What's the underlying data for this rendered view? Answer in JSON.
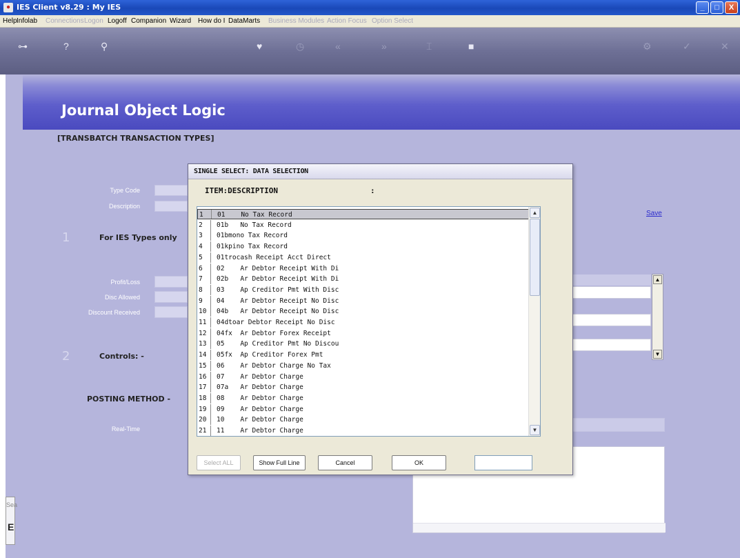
{
  "window": {
    "title": "IES Client v8.29 : My IES",
    "app_icon": "ies-logo-icon",
    "controls": {
      "minimize": "_",
      "maximize": "□",
      "close": "X"
    }
  },
  "menu": {
    "items": [
      {
        "label": "Help",
        "enabled": true
      },
      {
        "label": "Infolab",
        "enabled": true
      },
      {
        "label": "Connections",
        "enabled": false
      },
      {
        "label": "Logon",
        "enabled": false
      },
      {
        "label": "Logoff",
        "enabled": true
      },
      {
        "label": "Companion",
        "enabled": true
      },
      {
        "label": "Wizard",
        "enabled": true
      },
      {
        "label": "How do I",
        "enabled": true
      },
      {
        "label": "DataMarts",
        "enabled": true
      },
      {
        "label": "Business Modules",
        "enabled": false
      },
      {
        "label": "Action Focus",
        "enabled": false
      },
      {
        "label": "Option Select",
        "enabled": false
      }
    ]
  },
  "toolbar": {
    "icons": [
      "key-icon",
      "help-icon",
      "search-icon",
      "heart-icon",
      "clock-icon",
      "rewind-icon",
      "forward-icon",
      "bookmark-icon",
      "stop-icon",
      "settings-icon",
      "check-icon",
      "close-icon"
    ]
  },
  "page": {
    "heading": "Journal Object Logic",
    "subtitle": "[TRANSBATCH TRANSACTION TYPES]",
    "save_link": "Save",
    "fields": {
      "type_code": "Type Code",
      "description": "Description",
      "profit_loss": "Profit/Loss",
      "disc_allowed": "Disc Allowed",
      "discount_received": "Discount Received",
      "real_time": "Real-Time"
    },
    "sections": [
      {
        "number": "1",
        "title": "For IES Types only"
      },
      {
        "number": "2",
        "title": "Controls: -"
      },
      {
        "number": "",
        "title": "POSTING METHOD -"
      }
    ],
    "side_tab": {
      "label": "Sea",
      "letter": "E"
    }
  },
  "dialog": {
    "title": "SINGLE SELECT: DATA SELECTION",
    "column_header": "ITEM:DESCRIPTION",
    "column_header_colon": ":",
    "rows": [
      {
        "num": "1",
        "text": "01    No Tax Record",
        "selected": true
      },
      {
        "num": "2",
        "text": "01b   No Tax Record",
        "selected": false
      },
      {
        "num": "3",
        "text": "01bmono Tax Record",
        "selected": false
      },
      {
        "num": "4",
        "text": "01kpino Tax Record",
        "selected": false
      },
      {
        "num": "5",
        "text": "01trocash Receipt Acct Direct",
        "selected": false
      },
      {
        "num": "6",
        "text": "02    Ar Debtor Receipt With Di",
        "selected": false
      },
      {
        "num": "7",
        "text": "02b   Ar Debtor Receipt With Di",
        "selected": false
      },
      {
        "num": "8",
        "text": "03    Ap Creditor Pmt With Disc",
        "selected": false
      },
      {
        "num": "9",
        "text": "04    Ar Debtor Receipt No Disc",
        "selected": false
      },
      {
        "num": "10",
        "text": "04b   Ar Debtor Receipt No Disc",
        "selected": false
      },
      {
        "num": "11",
        "text": "04dtoar Debtor Receipt No Disc",
        "selected": false
      },
      {
        "num": "12",
        "text": "04fx  Ar Debtor Forex Receipt",
        "selected": false
      },
      {
        "num": "13",
        "text": "05    Ap Creditor Pmt No Discou",
        "selected": false
      },
      {
        "num": "14",
        "text": "05fx  Ap Creditor Forex Pmt",
        "selected": false
      },
      {
        "num": "15",
        "text": "06    Ar Debtor Charge No Tax",
        "selected": false
      },
      {
        "num": "16",
        "text": "07    Ar Debtor Charge",
        "selected": false
      },
      {
        "num": "17",
        "text": "07a   Ar Debtor Charge",
        "selected": false
      },
      {
        "num": "18",
        "text": "08    Ar Debtor Charge",
        "selected": false
      },
      {
        "num": "19",
        "text": "09    Ar Debtor Charge",
        "selected": false
      },
      {
        "num": "20",
        "text": "10    Ar Debtor Charge",
        "selected": false
      },
      {
        "num": "21",
        "text": "11    Ar Debtor Charge",
        "selected": false
      }
    ],
    "buttons": {
      "select_all": "Select ALL",
      "show_full_line": "Show Full Line",
      "cancel": "Cancel",
      "ok": "OK"
    },
    "filter_value": ""
  }
}
